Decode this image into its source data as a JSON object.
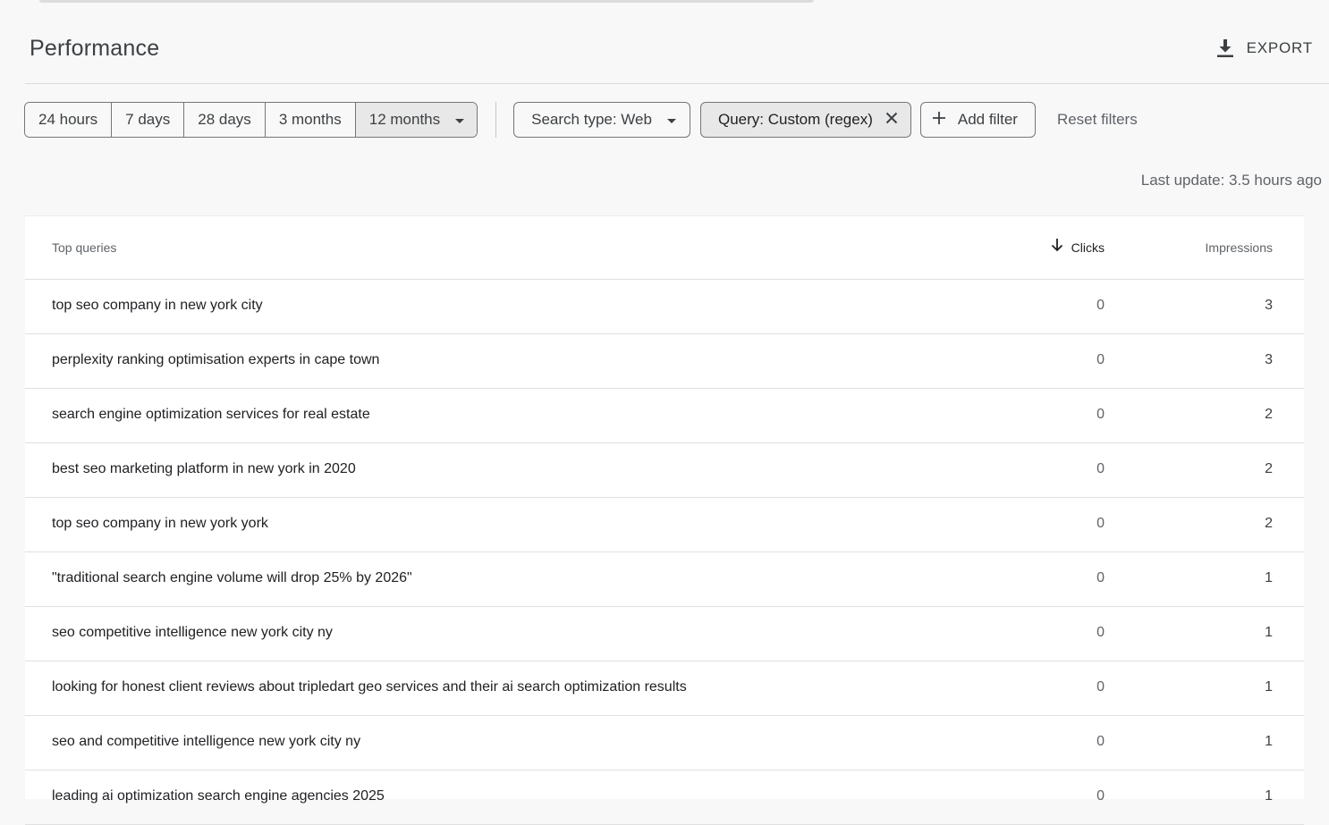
{
  "header": {
    "title": "Performance",
    "export_label": "EXPORT"
  },
  "filters": {
    "date_ranges": [
      "24 hours",
      "7 days",
      "28 days",
      "3 months",
      "12 months"
    ],
    "active_date_range": "12 months",
    "search_type_label": "Search type: Web",
    "query_filter_label": "Query: Custom (regex)",
    "add_filter_label": "Add filter",
    "reset_filters_label": "Reset filters"
  },
  "last_update": "Last update: 3.5 hours ago",
  "table": {
    "columns": {
      "query": "Top queries",
      "clicks": "Clicks",
      "impressions": "Impressions"
    },
    "sort_column": "Clicks",
    "sort_direction": "descending",
    "rows": [
      {
        "query": "top seo company in new york city",
        "clicks": "0",
        "impressions": "3"
      },
      {
        "query": "perplexity ranking optimisation experts in cape town",
        "clicks": "0",
        "impressions": "3"
      },
      {
        "query": "search engine optimization services for real estate",
        "clicks": "0",
        "impressions": "2"
      },
      {
        "query": "best seo marketing platform in new york in 2020",
        "clicks": "0",
        "impressions": "2"
      },
      {
        "query": "top seo company in new york york",
        "clicks": "0",
        "impressions": "2"
      },
      {
        "query": "\"traditional search engine volume will drop 25% by 2026\"",
        "clicks": "0",
        "impressions": "1"
      },
      {
        "query": "seo competitive intelligence new york city ny",
        "clicks": "0",
        "impressions": "1"
      },
      {
        "query": "looking for honest client reviews about tripledart geo services and their ai search optimization results",
        "clicks": "0",
        "impressions": "1"
      },
      {
        "query": "seo and competitive intelligence new york city ny",
        "clicks": "0",
        "impressions": "1"
      },
      {
        "query": "leading ai optimization search engine agencies 2025",
        "clicks": "0",
        "impressions": "1"
      }
    ]
  },
  "icons": {
    "export": "download-icon",
    "dropdown": "caret-down-icon",
    "remove_filter": "close-icon",
    "add_filter": "plus-icon",
    "sort": "arrow-down-icon"
  }
}
